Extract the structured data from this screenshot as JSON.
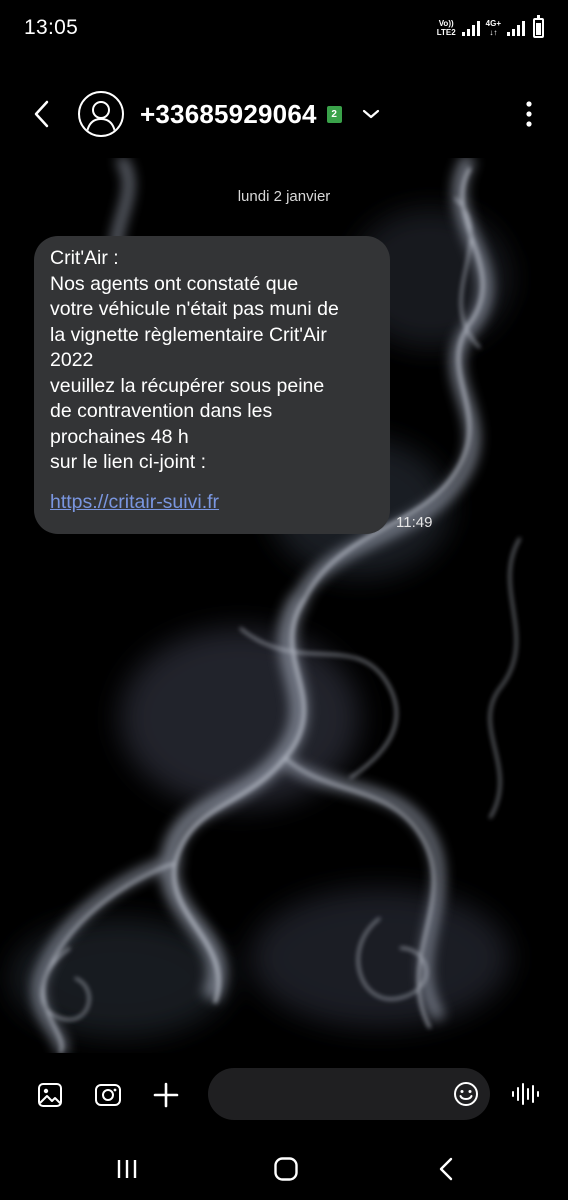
{
  "status_bar": {
    "time": "13:05",
    "volte_label_top": "Vo))",
    "volte_label_bottom": "LTE2",
    "network_label_top": "4G+",
    "network_label_bottom": "↓↑",
    "icons": [
      "volte-icon",
      "signal-icon",
      "signal-icon",
      "battery-icon"
    ]
  },
  "header": {
    "contact_name": "+33685929064",
    "sim_badge": "2",
    "icons": [
      "back-arrow-icon",
      "person-icon",
      "chevron-down-icon",
      "more-vertical-icon"
    ]
  },
  "conversation": {
    "date_divider": "lundi 2 janvier",
    "messages": [
      {
        "lines": [
          "Crit'Air :",
          "Nos agents ont constaté que",
          "votre véhicule n'était pas muni de",
          "la vignette règlementaire Crit'Air",
          "2022",
          "veuillez la récupérer sous peine",
          "de contravention dans les",
          "prochaines 48 h",
          "sur le lien ci-joint :"
        ],
        "link": "https://critair-suivi.fr",
        "time": "11:49"
      }
    ]
  },
  "composer": {
    "input_value": "",
    "input_placeholder": "",
    "icons": [
      "gallery-icon",
      "camera-icon",
      "plus-icon",
      "emoji-icon",
      "voice-waveform-icon"
    ]
  },
  "nav_bar": {
    "icons": [
      "recent-apps-icon",
      "home-icon",
      "back-icon"
    ]
  },
  "colors": {
    "background": "#000000",
    "bubble": "#333436",
    "link": "#7a96e0",
    "sim_badge": "#3aa24a",
    "input_background": "#1f1f21"
  }
}
